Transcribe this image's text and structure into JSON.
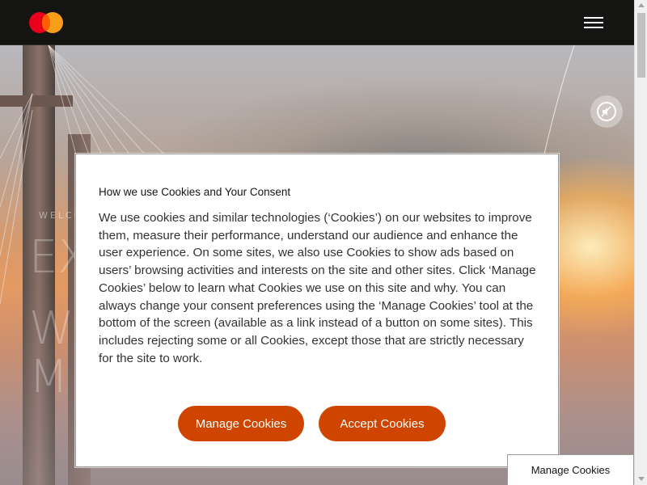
{
  "header": {
    "logo": {
      "icon": "mastercard-logo",
      "colors": {
        "red": "#eb001b",
        "orange": "#f79e1b",
        "overlap": "#ff5f00"
      }
    },
    "menu_icon": "hamburger-menu-icon"
  },
  "hero": {
    "mute_icon": "mute-icon",
    "welcome_text": "WELCO",
    "big_lines": [
      "EX",
      "W",
      "M"
    ]
  },
  "cookie_dialog": {
    "title": "How we use Cookies and Your Consent",
    "body": "We use cookies and similar technologies (‘Cookies’) on our websites to improve them, measure their performance, understand our audience and enhance the user experience. On some sites, we also use Cookies to show ads based on users’ browsing activities and interests on the site and other sites. Click ‘Manage Cookies’ below to learn what Cookies we use on this site and why. You can always change your consent preferences using the ‘Manage Cookies’ tool at the bottom of the screen (available as a link instead of a button on some sites). This includes rejecting some or all Cookies, except those that are strictly necessary for the site to work.",
    "manage_label": "Manage Cookies",
    "accept_label": "Accept Cookies",
    "accent_color": "#cf4500"
  },
  "manage_cookies_tab": {
    "label": "Manage Cookies"
  }
}
